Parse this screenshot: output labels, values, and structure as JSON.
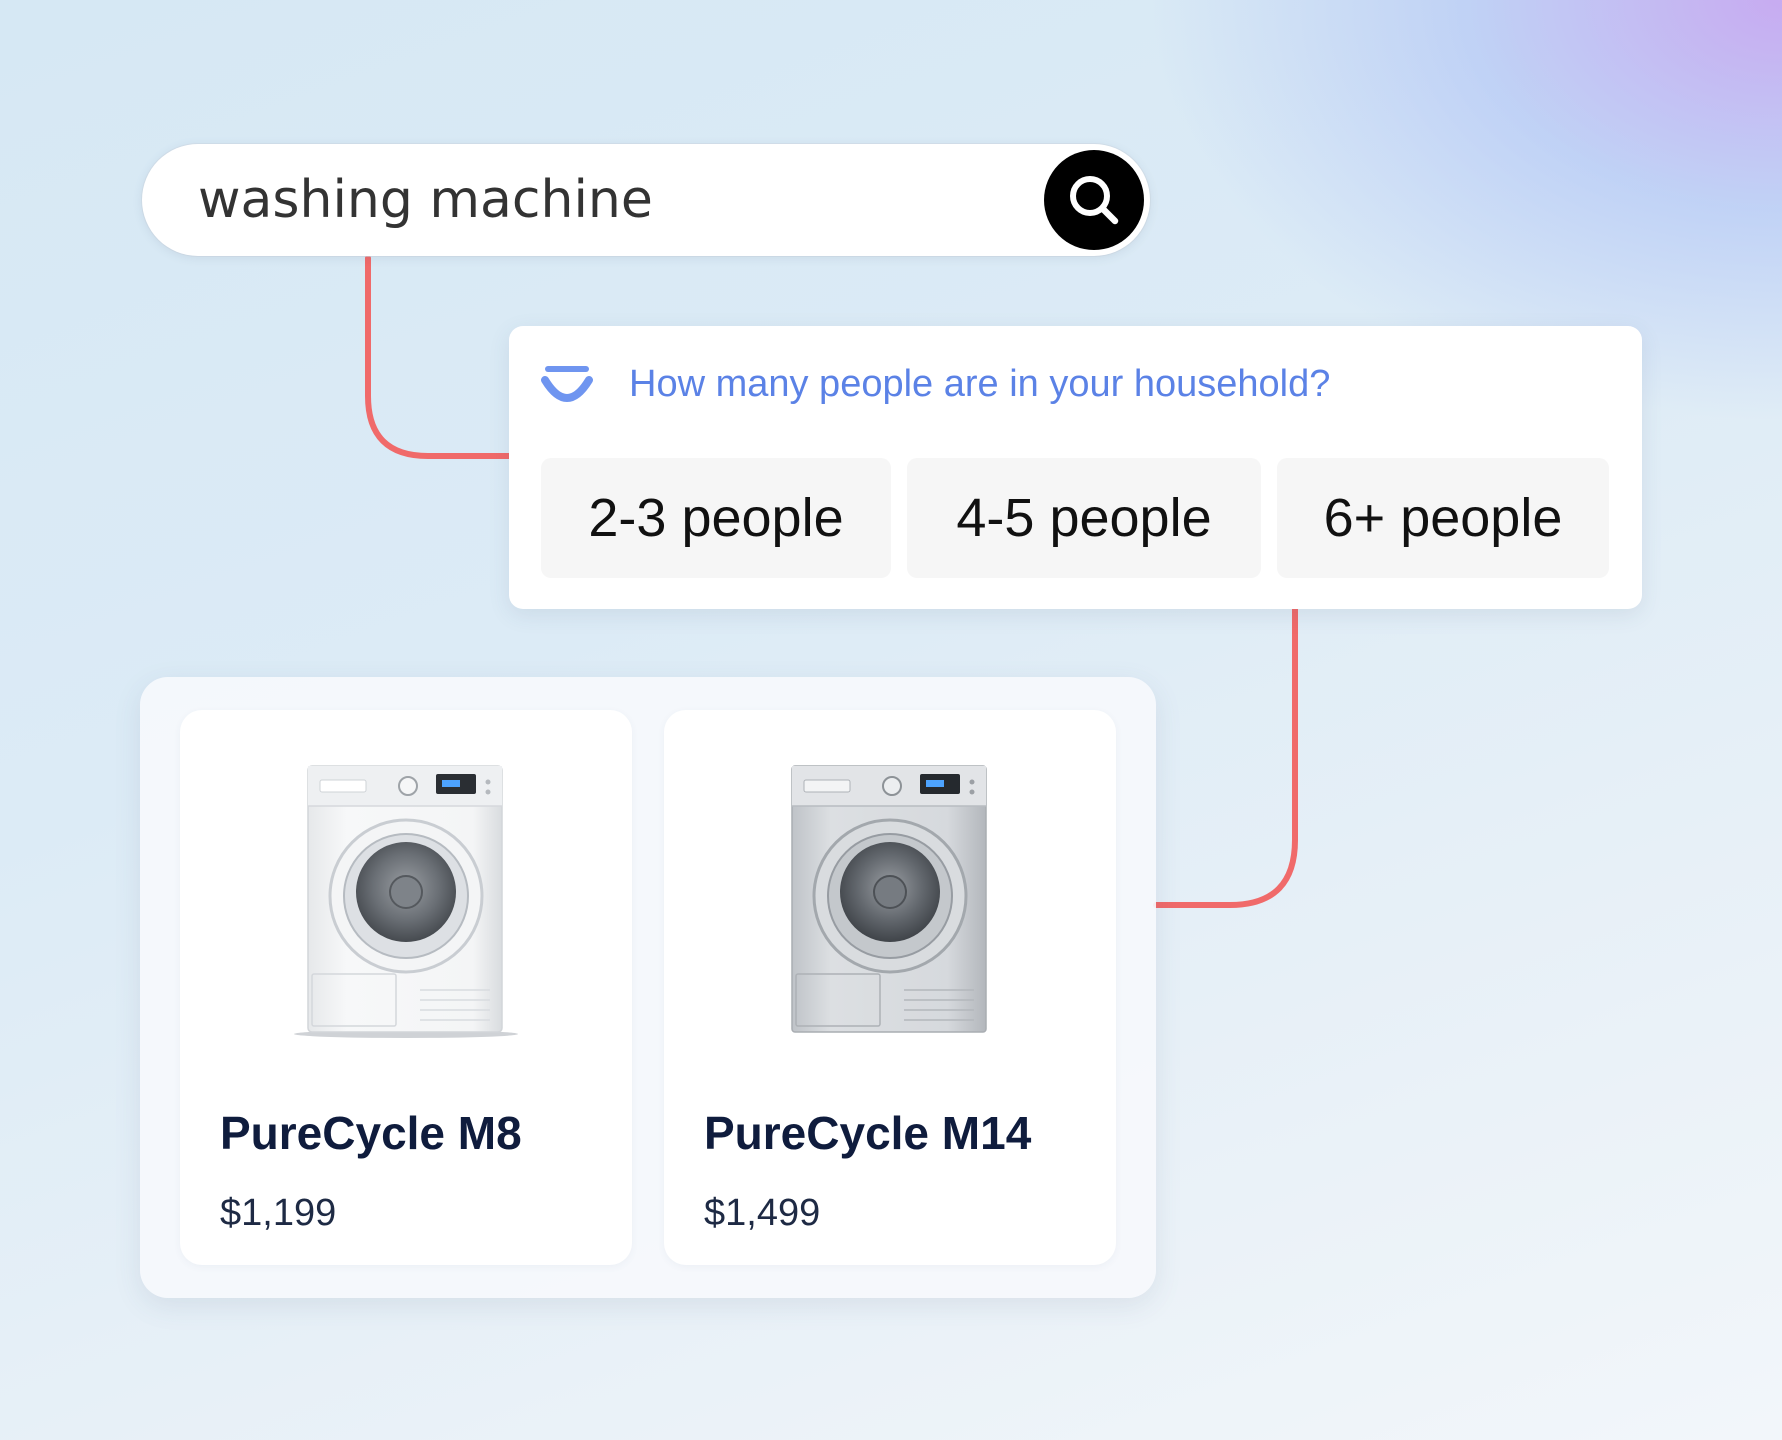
{
  "search": {
    "query": "washing machine",
    "button_icon": "search-icon"
  },
  "question": {
    "icon": "assistant-logo-icon",
    "text": "How many people are in your household?",
    "options": [
      {
        "label": "2-3 people"
      },
      {
        "label": "4-5 people"
      },
      {
        "label": "6+ people"
      }
    ]
  },
  "products": [
    {
      "name": "PureCycle M8",
      "price": "$1,199",
      "image_icon": "washing-machine-white-icon"
    },
    {
      "name": "PureCycle M14",
      "price": "$1,499",
      "image_icon": "washing-machine-silver-icon"
    }
  ],
  "colors": {
    "accent_blue": "#5b82e6",
    "connector": "#f06a6a",
    "search_button": "#000000",
    "product_name": "#0f1c3d"
  }
}
